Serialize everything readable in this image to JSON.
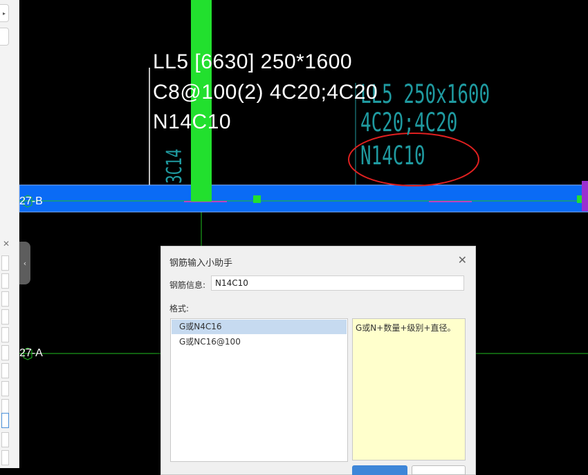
{
  "colors": {
    "canvas_bg": "#000000",
    "beam_fill": "#0a6bf5",
    "column_fill": "#22e02e",
    "grid_line": "#20c020",
    "label_text": "#ffffff",
    "label_highlight": "#c040c0",
    "cad_text": "#1f9aa0",
    "annotation_circle": "#e02020"
  },
  "beam_annotation": {
    "line1": "LL5 [6630] 250*1600",
    "line2": "C8@100(2) 4C20;4C20",
    "line3": "N14C10"
  },
  "cad_original": {
    "line1": "LL5 250x1600",
    "line2": "4C20;4C20",
    "line3": "N14C10",
    "column_rebar": "3C14"
  },
  "axes": {
    "top": "27-B",
    "bottom": "27-A"
  },
  "dialog": {
    "title": "钢筋输入小助手",
    "close_glyph": "✕",
    "rebar_info_label": "钢筋信息:",
    "rebar_info_value": "N14C10",
    "format_label": "格式:",
    "formats": [
      {
        "label": "G或N4C16",
        "selected": true
      },
      {
        "label": "G或NC16@100",
        "selected": false
      }
    ],
    "description": "G或N+数量+级别+直径。"
  },
  "left_panel": {
    "close_glyph": "✕",
    "expand_glyph": "▸",
    "collapse_glyph": "‹"
  }
}
